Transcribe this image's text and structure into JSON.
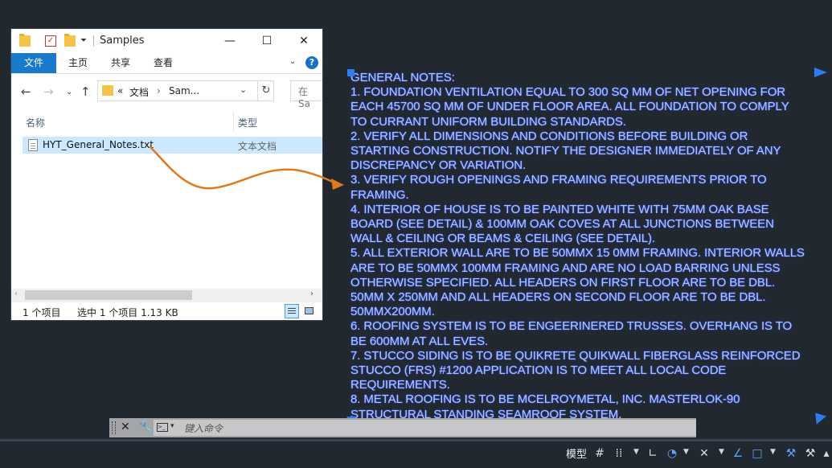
{
  "explorer": {
    "title": "Samples",
    "ribbon": {
      "file_tab": "文件",
      "tabs": [
        "主页",
        "共享",
        "查看"
      ],
      "help": "?"
    },
    "address": {
      "overflow": "«",
      "crumb1": "文档",
      "sep": "›",
      "crumb2": "Sam...",
      "search_placeholder": "在 Sa"
    },
    "columns": {
      "name": "名称",
      "type": "类型"
    },
    "file": {
      "name": "HYT_General_Notes.txt",
      "type": "文本文档"
    },
    "status": {
      "count": "1 个项目",
      "selection": "选中 1 个项目  1.13 KB"
    }
  },
  "notes": {
    "lines": [
      "GENERAL NOTES:",
      "1. FOUNDATION VENTILATION EQUAL TO 300 SQ MM OF NET OPENING FOR",
      "EACH 45700 SQ MM OF UNDER FLOOR AREA. ALL FOUNDATION TO COMPLY",
      "TO CURRANT UNIFORM BUILDING STANDARDS.",
      "2. VERIFY ALL DIMENSIONS AND CONDITIONS BEFORE BUILDING OR",
      "STARTING CONSTRUCTION. NOTIFY THE DESIGNER IMMEDIATELY OF ANY",
      "DISCREPANCY OR VARIATION.",
      "3. VERIFY ROUGH OPENINGS AND FRAMING REQUIREMENTS PRIOR TO",
      "FRAMING.",
      " 4. INTERIOR OF HOUSE IS TO BE PAINTED WHITE WITH 75MM OAK BASE",
      "BOARD (SEE DETAIL) & 100MM OAK COVES AT ALL JUNCTIONS BETWEEN",
      "WALL & CEILING OR BEAMS & CEILING (SEE DETAIL).",
      "5. ALL EXTERIOR WALL ARE TO BE 50MMX 15 0MM FRAMING. INTERIOR WALLS",
      "ARE TO BE 50MMX 100MM FRAMING AND ARE NO LOAD BARRING UNLESS",
      "OTHERWISE SPECIFIED. ALL HEADERS ON FIRST FLOOR ARE TO BE DBL.",
      "50MM X 250MM AND ALL HEADERS ON SECOND FLOOR ARE TO BE DBL.",
      "50MMX200MM.",
      "6. ROOFING SYSTEM IS TO BE ENGEERINERED TRUSSES. OVERHANG IS TO",
      "BE 600MM AT ALL EVES.",
      "7. STUCCO SIDING IS TO BE QUIKRETE QUIKWALL FIBERGLASS REINFORCED",
      "STUCCO (FRS) #1200 APPLICATION IS TO MEET ALL LOCAL CODE",
      "REQUIREMENTS.",
      "8. METAL ROOFING IS TO BE MCELROYMETAL, INC. MASTERLOK-90",
      "STRUCTURAL STANDING SEAMROOF SYSTEM."
    ]
  },
  "command": {
    "placeholder": "键入命令"
  },
  "status": {
    "model": "模型"
  },
  "colors": {
    "notes_text": "#a9c3ff",
    "grip": "#2d7cf0",
    "drag_arrow": "#e07a1f",
    "background": "#212830"
  }
}
